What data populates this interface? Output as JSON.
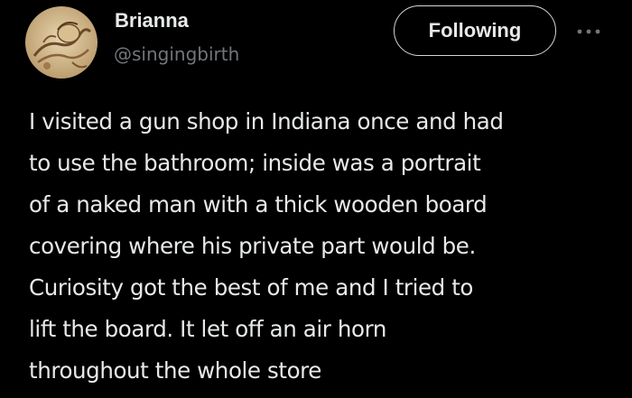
{
  "author": {
    "display_name": "Brianna",
    "handle": "@singingbirth",
    "avatar_icon": "sepia-illustration-avatar"
  },
  "actions": {
    "follow_label": "Following",
    "more_icon": "more-horizontal-icon"
  },
  "tweet": {
    "lines": [
      "I visited a gun shop in Indiana once and had",
      "to use the bathroom; inside was a portrait",
      "of a naked man with a thick wooden board",
      "covering where his private part would be.",
      "Curiosity got the best of me and I tried to",
      "lift the board. It let off an air horn",
      "throughout the whole store"
    ]
  },
  "colors": {
    "background": "#000000",
    "primary_text": "#e7e9ea",
    "secondary_text": "#71767b",
    "button_border": "#cfd9de"
  }
}
